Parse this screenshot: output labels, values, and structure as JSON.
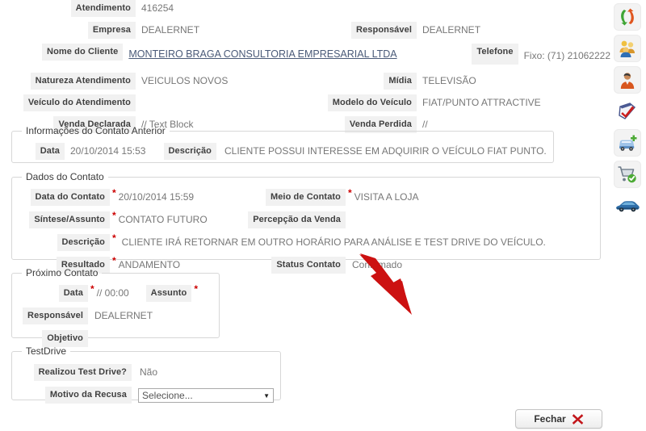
{
  "top_fields": [
    {
      "label": "Atendimento",
      "value": "416254",
      "label_r": "",
      "value_r": ""
    },
    {
      "label": "Empresa",
      "value": "DEALERNET",
      "label_r": "Responsável",
      "value_r": "DEALERNET"
    },
    {
      "label": "Nome do Cliente",
      "value": "MONTEIRO BRAGA CONSULTORIA EMPRESARIAL LTDA",
      "label_r": "Telefone",
      "value_r": "Fixo: (71) 21062222"
    },
    {
      "label": "Natureza Atendimento",
      "value": "VEICULOS NOVOS",
      "label_r": "Mídia",
      "value_r": "TELEVISÃO"
    },
    {
      "label": "Veículo do Atendimento",
      "value": "",
      "label_r": "Modelo do Veículo",
      "value_r": "FIAT/PUNTO ATTRACTIVE"
    },
    {
      "label": "Venda Declarada",
      "value": "// Text Block",
      "label_r": "Venda Perdida",
      "value_r": "//"
    }
  ],
  "contato_anterior": {
    "legend": "Informações do Contato Anterior",
    "data_label": "Data",
    "data_value": "20/10/2014 15:53",
    "descricao_label": "Descrição",
    "descricao_value": "CLIENTE POSSUI INTERESSE EM ADQUIRIR O VEÍCULO FIAT PUNTO."
  },
  "dados_contato": {
    "legend": "Dados do Contato",
    "data_contato_label": "Data do Contato",
    "data_contato_value": "20/10/2014 15:59",
    "meio_contato_label": "Meio de Contato",
    "meio_contato_value": "VISITA A LOJA",
    "sintese_label": "Síntese/Assunto",
    "sintese_value": "CONTATO FUTURO",
    "percepcao_label": "Percepção da Venda",
    "percepcao_value": "",
    "descricao_label": "Descrição",
    "descricao_value": "CLIENTE IRÁ RETORNAR EM OUTRO HORÁRIO PARA ANÁLISE E TEST DRIVE DO VEÍCULO.",
    "resultado_label": "Resultado",
    "resultado_value": "ANDAMENTO",
    "status_label": "Status Contato",
    "status_value": "Confirmado"
  },
  "proximo_contato": {
    "legend": "Próximo Contato",
    "data_label": "Data",
    "data_value": "// 00:00",
    "assunto_label": "Assunto",
    "assunto_value": "",
    "responsavel_label": "Responsável",
    "responsavel_value": "DEALERNET",
    "objetivo_label": "Objetivo",
    "objetivo_value": ""
  },
  "testdrive": {
    "legend": "TestDrive",
    "realizou_label": "Realizou Test Drive?",
    "realizou_value": "Não",
    "motivo_label": "Motivo da Recusa",
    "motivo_value": "Selecione..."
  },
  "footer": {
    "close_label": "Fechar"
  },
  "rail": {
    "icons": [
      {
        "name": "exchange-arrows-icon"
      },
      {
        "name": "group-users-icon"
      },
      {
        "name": "person-icon"
      },
      {
        "name": "checklist-clipboard-icon"
      },
      {
        "name": "car-add-icon"
      },
      {
        "name": "shopping-cart-check-icon"
      },
      {
        "name": "blue-car-icon"
      }
    ]
  },
  "annotation": {
    "arrow_color": "#cc1111"
  },
  "colors": {
    "label_bg": "#f1f1f1",
    "value_text": "#777777",
    "required": "#cc0000",
    "link": "#4a5a78",
    "fieldset_border": "#d7d7d7"
  }
}
